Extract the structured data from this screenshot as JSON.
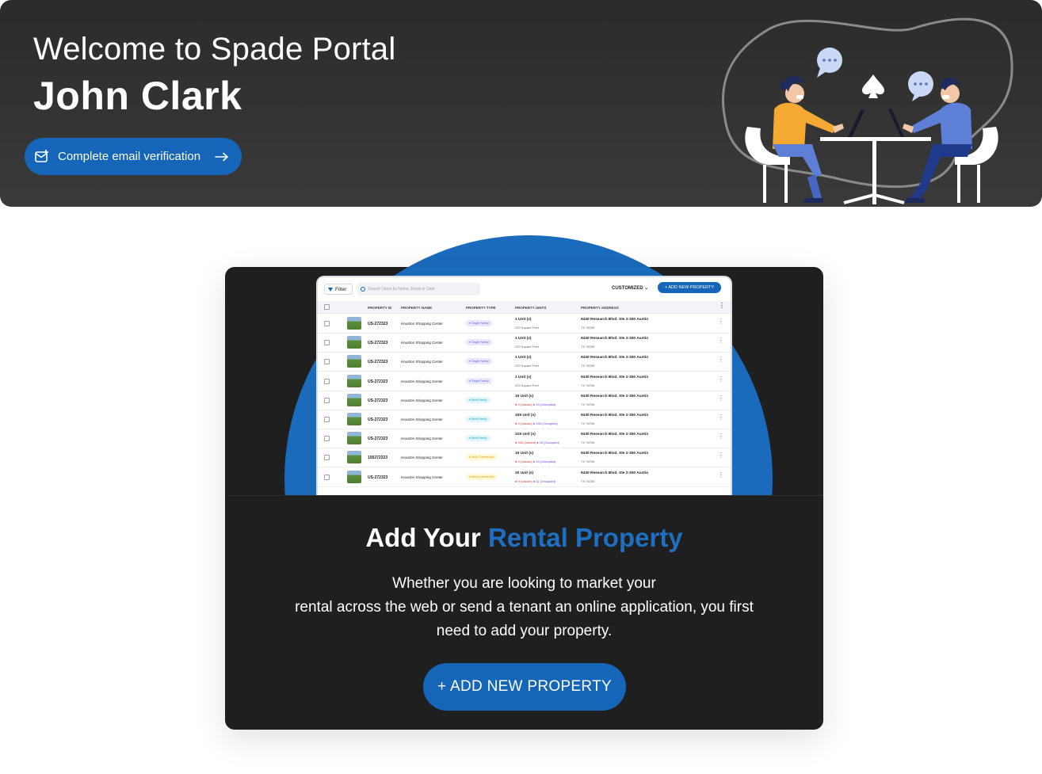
{
  "banner": {
    "welcome": "Welcome to Spade Portal",
    "user_name": "John Clark",
    "verify_button": "Complete email verification"
  },
  "card": {
    "title_part1": "Add Your ",
    "title_accent": "Rental Property",
    "description_line1": "Whether you are looking to market your",
    "description_line2": "rental across the web or send a tenant an online application, you first",
    "description_line3": "need to add your property.",
    "add_button": "+ ADD NEW PROPERTY"
  },
  "preview": {
    "filter_label": "Filter",
    "search_placeholder": "Search Users by Name, Email or Date",
    "customized_label": "CUSTOMIZED",
    "add_button": "+ ADD NEW PROPERTY",
    "columns": [
      "PROPERTY ID",
      "PROPERTY NAME",
      "PROPERTY TYPE",
      "PROPERTY UNITS",
      "PROPERTY ADDRESS"
    ],
    "rows": [
      {
        "id": "US-272323",
        "name": "Houston Shopping Center",
        "type": "Single Family",
        "type_class": "t-single",
        "units": "1 Unit (s)",
        "sub": "220 Square Feet",
        "address": "9430 Research Blvd. Ste 2-350 Austin",
        "zip": "TX 78759"
      },
      {
        "id": "US-272323",
        "name": "Houston Shopping Center",
        "type": "Single Family",
        "type_class": "t-single",
        "units": "1 Unit (s)",
        "sub": "220 Square Feet",
        "address": "9430 Research Blvd. Ste 2-350 Austin",
        "zip": "TX 78759"
      },
      {
        "id": "US-272323",
        "name": "Houston Shopping Center",
        "type": "Single Family",
        "type_class": "t-single",
        "units": "1 Unit (s)",
        "sub": "220 Square Feet",
        "address": "9430 Research Blvd. Ste 2-350 Austin",
        "zip": "TX 78759"
      },
      {
        "id": "US-272323",
        "name": "Houston Shopping Center",
        "type": "Single Family",
        "type_class": "t-single",
        "units": "1 Unit (s)",
        "sub": "220 Square Feet",
        "address": "9430 Research Blvd. Ste 2-350 Austin",
        "zip": "TX 78759"
      },
      {
        "id": "US-272323",
        "name": "Houston Shopping Center",
        "type": "Multi-Family",
        "type_class": "t-multi",
        "units": "19 Unit (s)",
        "vacant": "● 9 (Vacant)",
        "occupied": "● 10 (Occupied)",
        "address": "9430 Research Blvd. Ste 2-350 Austin",
        "zip": "TX 78759"
      },
      {
        "id": "US-272323",
        "name": "Houston Shopping Center",
        "type": "Multi-Family",
        "type_class": "t-multi",
        "units": "109 Unit (s)",
        "vacant": "● 9 (Vacant)",
        "occupied": "● 100 (Occupied)",
        "address": "9430 Research Blvd. Ste 2-350 Austin",
        "zip": "TX 78759"
      },
      {
        "id": "US-272323",
        "name": "Houston Shopping Center",
        "type": "Multi-Family",
        "type_class": "t-multi",
        "units": "319 Unit (s)",
        "vacant": "● 300 (Vacant)",
        "occupied": "● 19 (Occupied)",
        "address": "9430 Research Blvd. Ste 2-350 Austin",
        "zip": "TX 78759"
      },
      {
        "id": "100272323",
        "name": "Houston Shopping Center",
        "type": "Multi-Commercial",
        "type_class": "t-comm",
        "units": "19 Unit (s)",
        "vacant": "● 9 (Vacant)",
        "occupied": "● 10 (Occupied)",
        "address": "9430 Research Blvd. Ste 2-350 Austin",
        "zip": "TX 78759"
      },
      {
        "id": "US-272323",
        "name": "Houston Shopping Center",
        "type": "Multi-Commercial",
        "type_class": "t-comm",
        "units": "20 Unit (s)",
        "vacant": "● 9 (Vacant)",
        "occupied": "● 11 (Occupied)",
        "address": "9430 Research Blvd. Ste 2-350 Austin",
        "zip": "TX 78759"
      }
    ]
  },
  "colors": {
    "accent": "#1565b8",
    "dark_bg": "#1f1f1f",
    "banner_bg": "#333333"
  },
  "icons": {
    "verify": "mail-check-icon",
    "arrow": "arrow-right-icon",
    "logo": "spade-icon"
  }
}
